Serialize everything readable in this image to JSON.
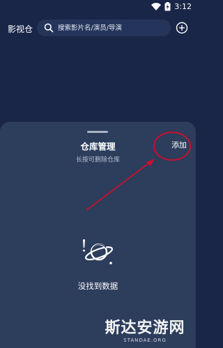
{
  "status_bar": {
    "time": "3:12"
  },
  "header": {
    "title": "影视仓",
    "search_placeholder": "搜索影片名/演员/导演"
  },
  "sheet": {
    "title": "仓库管理",
    "subtitle": "长按可删除仓库",
    "add_label": "添加",
    "empty_text": "没找到数据"
  },
  "watermark": {
    "text": "斯达安游网",
    "subtext": "STANDAE.ORG"
  },
  "colors": {
    "background": "#1a2648",
    "sheet": "#2d3d5c",
    "annotation": "#c8102e"
  },
  "icons": [
    "wifi-icon",
    "battery-icon",
    "search-icon",
    "add-circle-icon",
    "planet-icon",
    "exclamation-icon"
  ]
}
